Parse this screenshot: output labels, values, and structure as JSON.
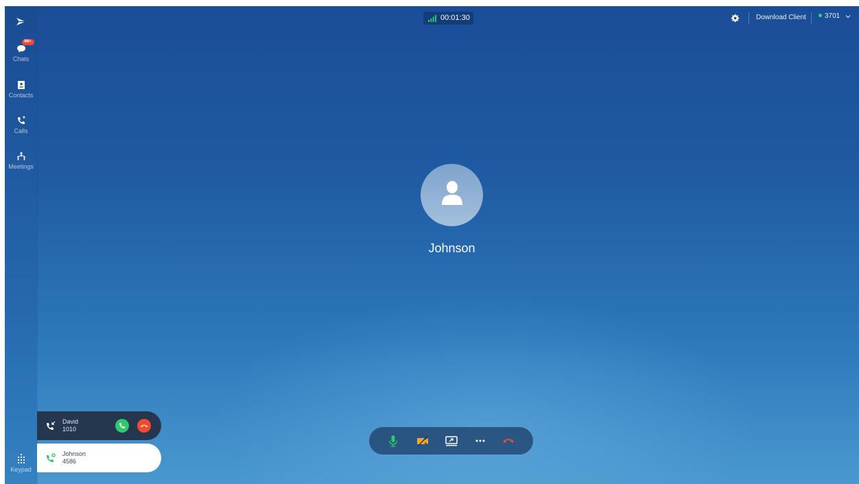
{
  "sidebar": {
    "items": [
      {
        "label": "Chats",
        "icon": "chat-icon",
        "badge": "99+"
      },
      {
        "label": "Contacts",
        "icon": "contacts-icon"
      },
      {
        "label": "Calls",
        "icon": "phone-icon"
      },
      {
        "label": "Meetings",
        "icon": "meetings-icon"
      }
    ],
    "keypad_label": "Keypad"
  },
  "topbar": {
    "call_timer": "00:01:30",
    "download_label": "Download Client",
    "account_number": "3701",
    "account_status_color": "#35d07a"
  },
  "active_call": {
    "caller_name": "Johnson"
  },
  "call_list": [
    {
      "name": "David",
      "number": "1010",
      "state": "incoming"
    },
    {
      "name": "Johnson",
      "number": "4586",
      "state": "active"
    }
  ],
  "controls": [
    "microphone-icon",
    "video-off-icon",
    "screen-share-icon",
    "more-icon",
    "hang-up-icon"
  ],
  "colors": {
    "accept": "#2fc86a",
    "reject": "#f14b2f",
    "hangup": "#f14b2f",
    "video_off": "#f5a623",
    "mic": "#2fc86a",
    "signal": "#2fc86a"
  }
}
